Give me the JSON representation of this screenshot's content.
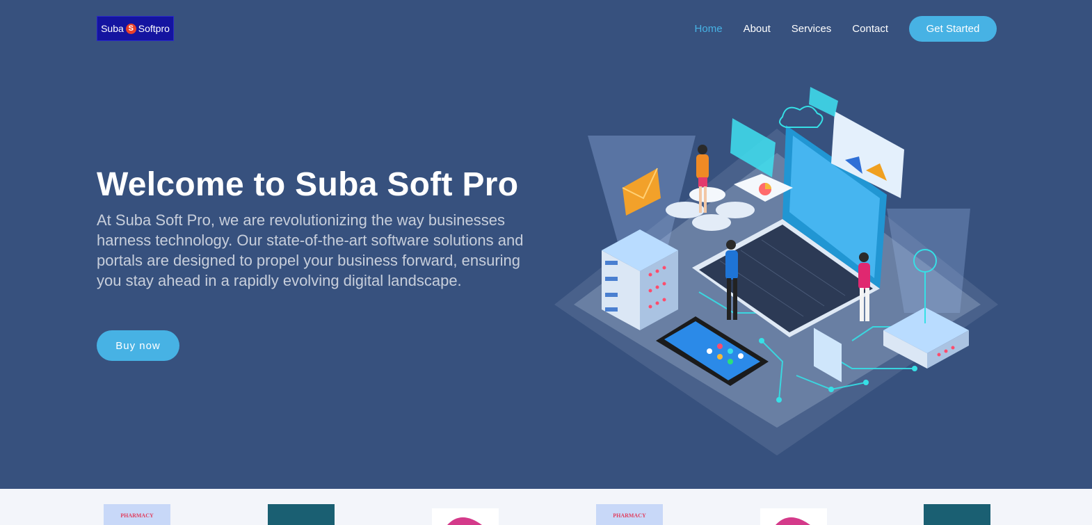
{
  "logo": {
    "left_text": "Suba",
    "badge": "S",
    "right_text": "Softpro"
  },
  "nav": {
    "items": [
      {
        "label": "Home",
        "active": true
      },
      {
        "label": "About",
        "active": false
      },
      {
        "label": "Services",
        "active": false
      },
      {
        "label": "Contact",
        "active": false
      }
    ],
    "cta_label": "Get Started"
  },
  "hero": {
    "title": "Welcome to Suba Soft Pro",
    "description": "At Suba Soft Pro, we are revolutionizing the way businesses harness technology. Our state-of-the-art software solutions and portals are designed to propel your business forward, ensuring you stay ahead in a rapidly evolving digital landscape.",
    "button_label": "Buy now"
  },
  "clients": [
    {
      "type": "pharmacy",
      "text": "PHARMACY"
    },
    {
      "type": "teal",
      "text": ""
    },
    {
      "type": "pink",
      "text": ""
    },
    {
      "type": "pharmacy",
      "text": "PHARMACY"
    },
    {
      "type": "pink",
      "text": ""
    },
    {
      "type": "teal",
      "text": ""
    }
  ],
  "colors": {
    "background": "#37517e",
    "accent": "#47b2e4",
    "clients_bar": "#f3f5fa"
  },
  "icons": {
    "hero_illustration": "isometric-tech-illustration"
  }
}
